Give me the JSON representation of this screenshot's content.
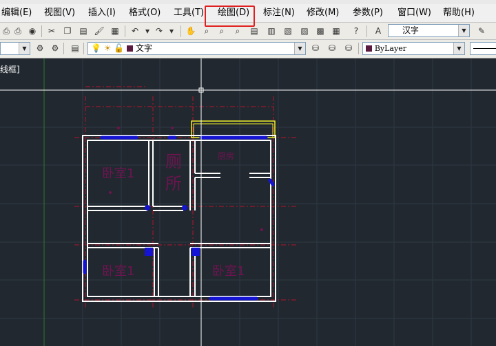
{
  "menu": {
    "items": [
      {
        "label": "编辑(E)"
      },
      {
        "label": "视图(V)"
      },
      {
        "label": "插入(I)"
      },
      {
        "label": "格式(O)"
      },
      {
        "label": "工具(T)"
      },
      {
        "label": "绘图(D)"
      },
      {
        "label": "标注(N)"
      },
      {
        "label": "修改(M)"
      },
      {
        "label": "参数(P)"
      },
      {
        "label": "窗口(W)"
      },
      {
        "label": "帮助(H)"
      }
    ]
  },
  "toolbar": {
    "text_style": "汉字",
    "layer": "文字",
    "color": "ByLayer"
  },
  "viewport": {
    "label": "线框]"
  },
  "drawing": {
    "room_labels": [
      "卧室1",
      "厕",
      "所",
      "厨房",
      "卧室1",
      "卧室1"
    ],
    "colors": {
      "walls": "#ffffff",
      "windows": "#1414d2",
      "axis": "#b4142c",
      "text": "#6e1450",
      "crosshair": "#ffffff",
      "selection": "#f0f028"
    }
  }
}
